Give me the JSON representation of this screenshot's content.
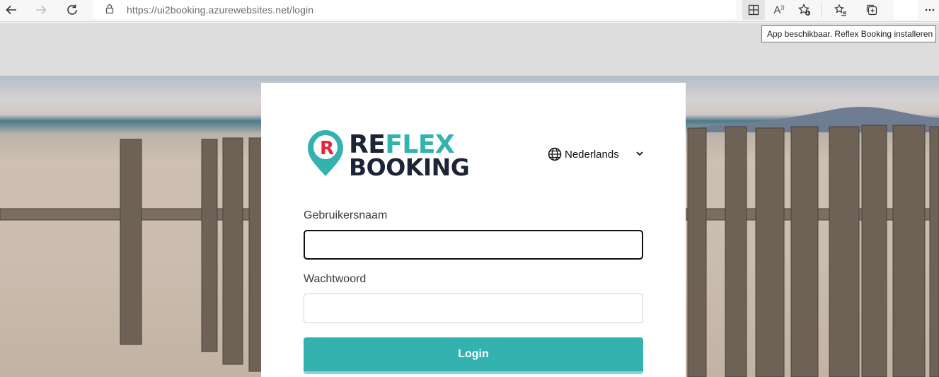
{
  "browser": {
    "url": "https://ui2booking.azurewebsites.net/login",
    "tooltip": "App beschikbaar. Reflex Booking installeren",
    "read_aloud_glyph": "A"
  },
  "brand": {
    "line1_a": "RE",
    "line1_b": "FLEX",
    "line2": "BOOKING",
    "logo_letter": "R",
    "colors": {
      "accent": "#33b3b0",
      "dark": "#1c2435",
      "logo_red": "#e3263b"
    }
  },
  "language": {
    "selected": "Nederlands"
  },
  "form": {
    "username_label": "Gebruikersnaam",
    "username_value": "",
    "password_label": "Wachtwoord",
    "password_value": "",
    "login_label": "Login"
  }
}
